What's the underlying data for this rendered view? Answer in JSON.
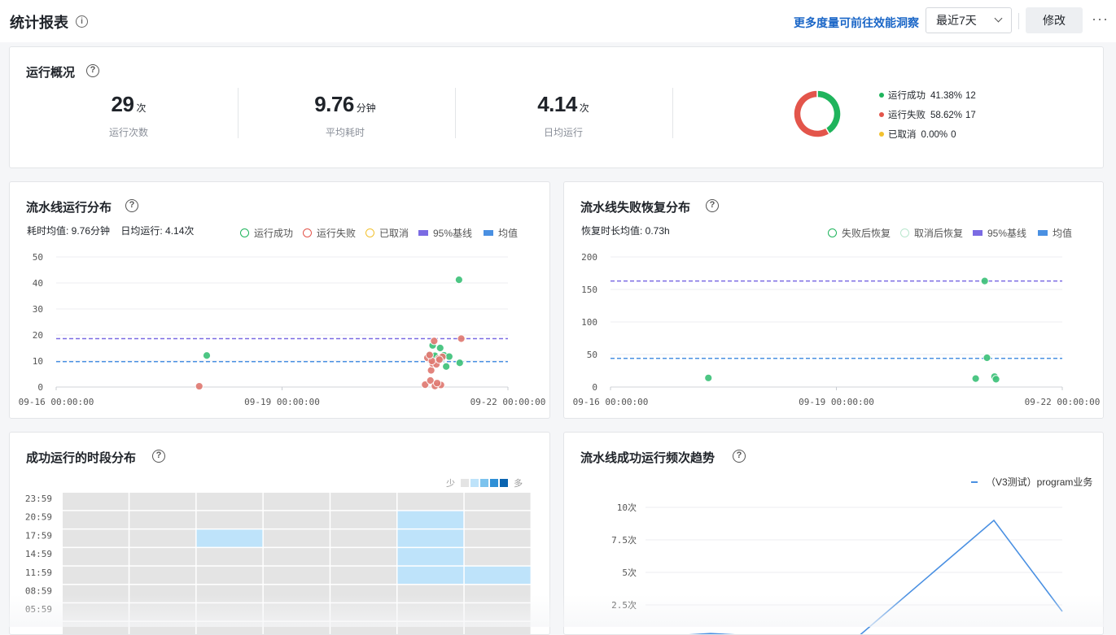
{
  "header": {
    "title": "统计报表",
    "info_glyph": "i",
    "insight_link": "更多度量可前往效能洞察",
    "range_value": "最近7天",
    "edit_label": "修改",
    "more_glyph": "···"
  },
  "overview": {
    "title": "运行概况",
    "stats": [
      {
        "value": "29",
        "unit": "次",
        "label": "运行次数"
      },
      {
        "value": "9.76",
        "unit": "分钟",
        "label": "平均耗时"
      },
      {
        "value": "4.14",
        "unit": "次",
        "label": "日均运行"
      }
    ],
    "donut_legend": [
      {
        "name": "运行成功",
        "percent": "41.38%",
        "count": "12",
        "color": "#1fb45c"
      },
      {
        "name": "运行失败",
        "percent": "58.62%",
        "count": "17",
        "color": "#e3554b"
      },
      {
        "name": "已取消",
        "percent": "0.00%",
        "count": "0",
        "color": "#f2c12e"
      }
    ]
  },
  "run_distribution": {
    "title": "流水线运行分布",
    "meta_avg": "耗时均值: 9.76分钟",
    "meta_daily": "日均运行: 4.14次",
    "legend": {
      "success": "运行成功",
      "fail": "运行失败",
      "cancel": "已取消",
      "p95": "95%基线",
      "mean": "均值"
    }
  },
  "recovery_distribution": {
    "title": "流水线失败恢复分布",
    "meta_avg": "恢复时长均值: 0.73h",
    "legend": {
      "after_fail": "失败后恢复",
      "after_cancel": "取消后恢复",
      "p95": "95%基线",
      "mean": "均值"
    }
  },
  "time_slot": {
    "title": "成功运行的时段分布",
    "legend_less": "少",
    "legend_more": "多",
    "scale_colors": [
      "#e4e4e4",
      "#bee3fa",
      "#7cc3ee",
      "#2e8fd6",
      "#0b64b0"
    ]
  },
  "trend": {
    "title": "流水线成功运行频次趋势",
    "legend_series": "（V3测试）program业务"
  },
  "chart_data": [
    {
      "type": "scatter",
      "title": "流水线运行分布",
      "xlabel": "",
      "ylabel": "",
      "x_ticks": [
        "09-16 00:00:00",
        "09-19 00:00:00",
        "09-22 00:00:00"
      ],
      "ylim": [
        0,
        50
      ],
      "y_ticks": [
        0,
        10,
        20,
        30,
        40,
        50
      ],
      "baselines": {
        "p95": 18.6,
        "mean": 9.76
      },
      "series": [
        {
          "name": "运行成功",
          "color": "#3ec27a",
          "points": [
            [
              3.0,
              12.1
            ],
            [
              5.95,
              12.0
            ],
            [
              6.0,
              16.0
            ],
            [
              6.05,
              11.5
            ],
            [
              6.1,
              15.0
            ],
            [
              6.12,
              11.0
            ],
            [
              6.15,
              12.2
            ],
            [
              6.18,
              7.9
            ],
            [
              6.22,
              11.7
            ],
            [
              6.35,
              41.2
            ],
            [
              6.36,
              9.3
            ],
            [
              6.03,
              12.0
            ]
          ]
        },
        {
          "name": "运行失败",
          "color": "#e07a72",
          "points": [
            [
              2.9,
              0.3
            ],
            [
              5.9,
              0.9
            ],
            [
              5.93,
              11.2
            ],
            [
              5.97,
              2.5
            ],
            [
              5.98,
              6.4
            ],
            [
              6.0,
              9.0
            ],
            [
              6.02,
              17.7
            ],
            [
              6.03,
              0.4
            ],
            [
              6.05,
              8.7
            ],
            [
              6.08,
              11.0
            ],
            [
              6.11,
              0.8
            ],
            [
              6.13,
              11.6
            ],
            [
              6.38,
              18.6
            ],
            [
              5.99,
              10.0
            ],
            [
              6.06,
              1.5
            ],
            [
              5.96,
              12.3
            ],
            [
              6.09,
              10.5
            ]
          ]
        },
        {
          "name": "已取消",
          "color": "#f2c12e",
          "points": []
        }
      ]
    },
    {
      "type": "scatter",
      "title": "流水线失败恢复分布",
      "xlabel": "",
      "ylabel": "",
      "x_ticks": [
        "09-16 00:00:00",
        "09-19 00:00:00",
        "09-22 00:00:00"
      ],
      "ylim": [
        0,
        200
      ],
      "y_ticks": [
        0,
        50,
        100,
        150,
        200
      ],
      "baselines": {
        "p95": 163,
        "mean": 44
      },
      "series": [
        {
          "name": "失败后恢复",
          "color": "#3ec27a",
          "points": [
            [
              2.3,
              14
            ],
            [
              5.85,
              13
            ],
            [
              5.97,
              163
            ],
            [
              6.0,
              45
            ],
            [
              6.1,
              16
            ],
            [
              6.12,
              12
            ]
          ]
        },
        {
          "name": "取消后恢复",
          "color": "#b9e7ce",
          "points": []
        }
      ]
    },
    {
      "type": "heatmap",
      "title": "成功运行的时段分布",
      "y_ticks": [
        "23:59",
        "20:59",
        "17:59",
        "14:59",
        "11:59",
        "08:59",
        "05:59"
      ],
      "columns": 7,
      "rows": 8,
      "levels": [
        [
          0,
          0,
          0,
          0,
          0,
          0,
          0
        ],
        [
          0,
          0,
          0,
          0,
          0,
          1,
          0
        ],
        [
          0,
          0,
          1,
          0,
          0,
          1,
          0
        ],
        [
          0,
          0,
          0,
          0,
          0,
          1,
          0
        ],
        [
          0,
          0,
          0,
          0,
          0,
          1,
          1
        ],
        [
          0,
          0,
          0,
          0,
          0,
          0,
          0
        ],
        [
          0,
          0,
          0,
          0,
          0,
          0,
          0
        ],
        [
          0,
          0,
          0,
          0,
          0,
          0,
          0
        ]
      ]
    },
    {
      "type": "line",
      "title": "流水线成功运行频次趋势",
      "y_ticks": [
        "2.5次",
        "5次",
        "7.5次",
        "10次"
      ],
      "ylim": [
        0,
        10
      ],
      "series": [
        {
          "name": "（V3测试）program业务",
          "color": "#4a90e2",
          "values": [
            0.0,
            0.3,
            0.0,
            0.0,
            9.0,
            2.0
          ]
        }
      ]
    }
  ]
}
